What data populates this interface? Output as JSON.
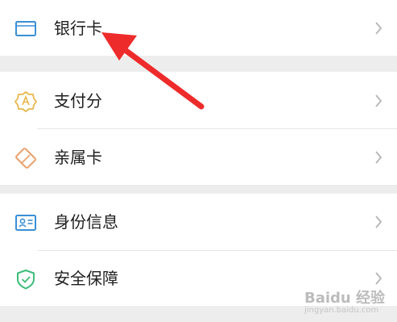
{
  "menu": {
    "bank_card": {
      "label": "银行卡",
      "icon": "card-icon",
      "color": "#3a8fd6"
    },
    "payment_score": {
      "label": "支付分",
      "icon": "badge-icon",
      "color": "#e8b64a"
    },
    "family_card": {
      "label": "亲属卡",
      "icon": "family-card-icon",
      "color": "#e8a06a"
    },
    "identity_info": {
      "label": "身份信息",
      "icon": "id-card-icon",
      "color": "#3a8fd6"
    },
    "security": {
      "label": "安全保障",
      "icon": "shield-icon",
      "color": "#3dbd7a"
    }
  },
  "watermark": {
    "brand": "Baidu 经验",
    "url": "jingyan.baidu.com"
  },
  "annotation": {
    "icon": "red-arrow-icon",
    "color": "#ee2b2b"
  }
}
